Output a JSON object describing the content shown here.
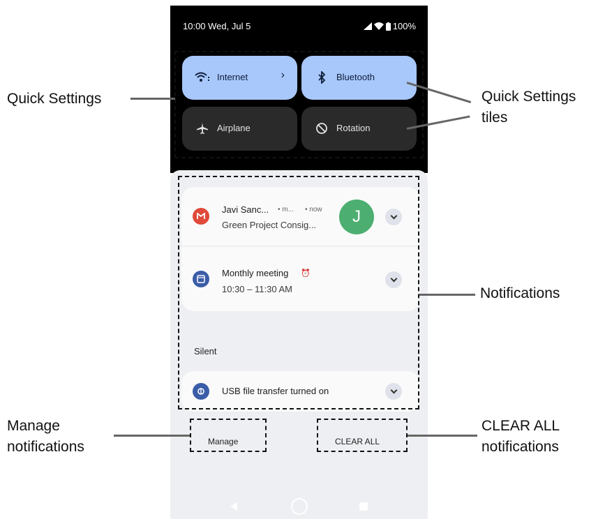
{
  "status_bar": {
    "time": "10:00 Wed, Jul 5",
    "battery": "100%"
  },
  "quick_settings": {
    "tiles": [
      {
        "label": "Internet",
        "icon": "wifi-icon",
        "state": "on"
      },
      {
        "label": "Bluetooth",
        "icon": "bluetooth-icon",
        "state": "on"
      },
      {
        "label": "Airplane",
        "icon": "airplane-icon",
        "state": "off"
      },
      {
        "label": "Rotation",
        "icon": "rotation-icon",
        "state": "off"
      }
    ]
  },
  "notifications": [
    {
      "app_icon": "gmail-icon",
      "title": "Javi Sanc...",
      "sub_app": "• m...",
      "time": "• now",
      "text": "Green Project Consig...",
      "avatar_letter": "J"
    },
    {
      "app_icon": "calendar-icon",
      "title": "Monthly meeting",
      "text": "10:30 – 11:30 AM"
    }
  ],
  "silent": {
    "header": "Silent",
    "item": {
      "app_icon": "usb-icon",
      "title": "USB file transfer turned on"
    }
  },
  "buttons": {
    "manage": "Manage",
    "clear_all": "CLEAR ALL"
  },
  "callouts": {
    "quick_settings": "Quick Settings",
    "quick_settings_tiles_1": "Quick Settings",
    "quick_settings_tiles_2": "tiles",
    "notifications": "Notifications",
    "manage_1": "Manage",
    "manage_2": "notifications",
    "clear_1": "CLEAR ALL",
    "clear_2": "notifications"
  },
  "colors": {
    "tile_on": "#a8c7fa",
    "tile_off": "#2a2a2a",
    "gmail_red": "#e04a3a",
    "avatar_green": "#4caf71",
    "calendar_blue": "#3b5da8"
  }
}
